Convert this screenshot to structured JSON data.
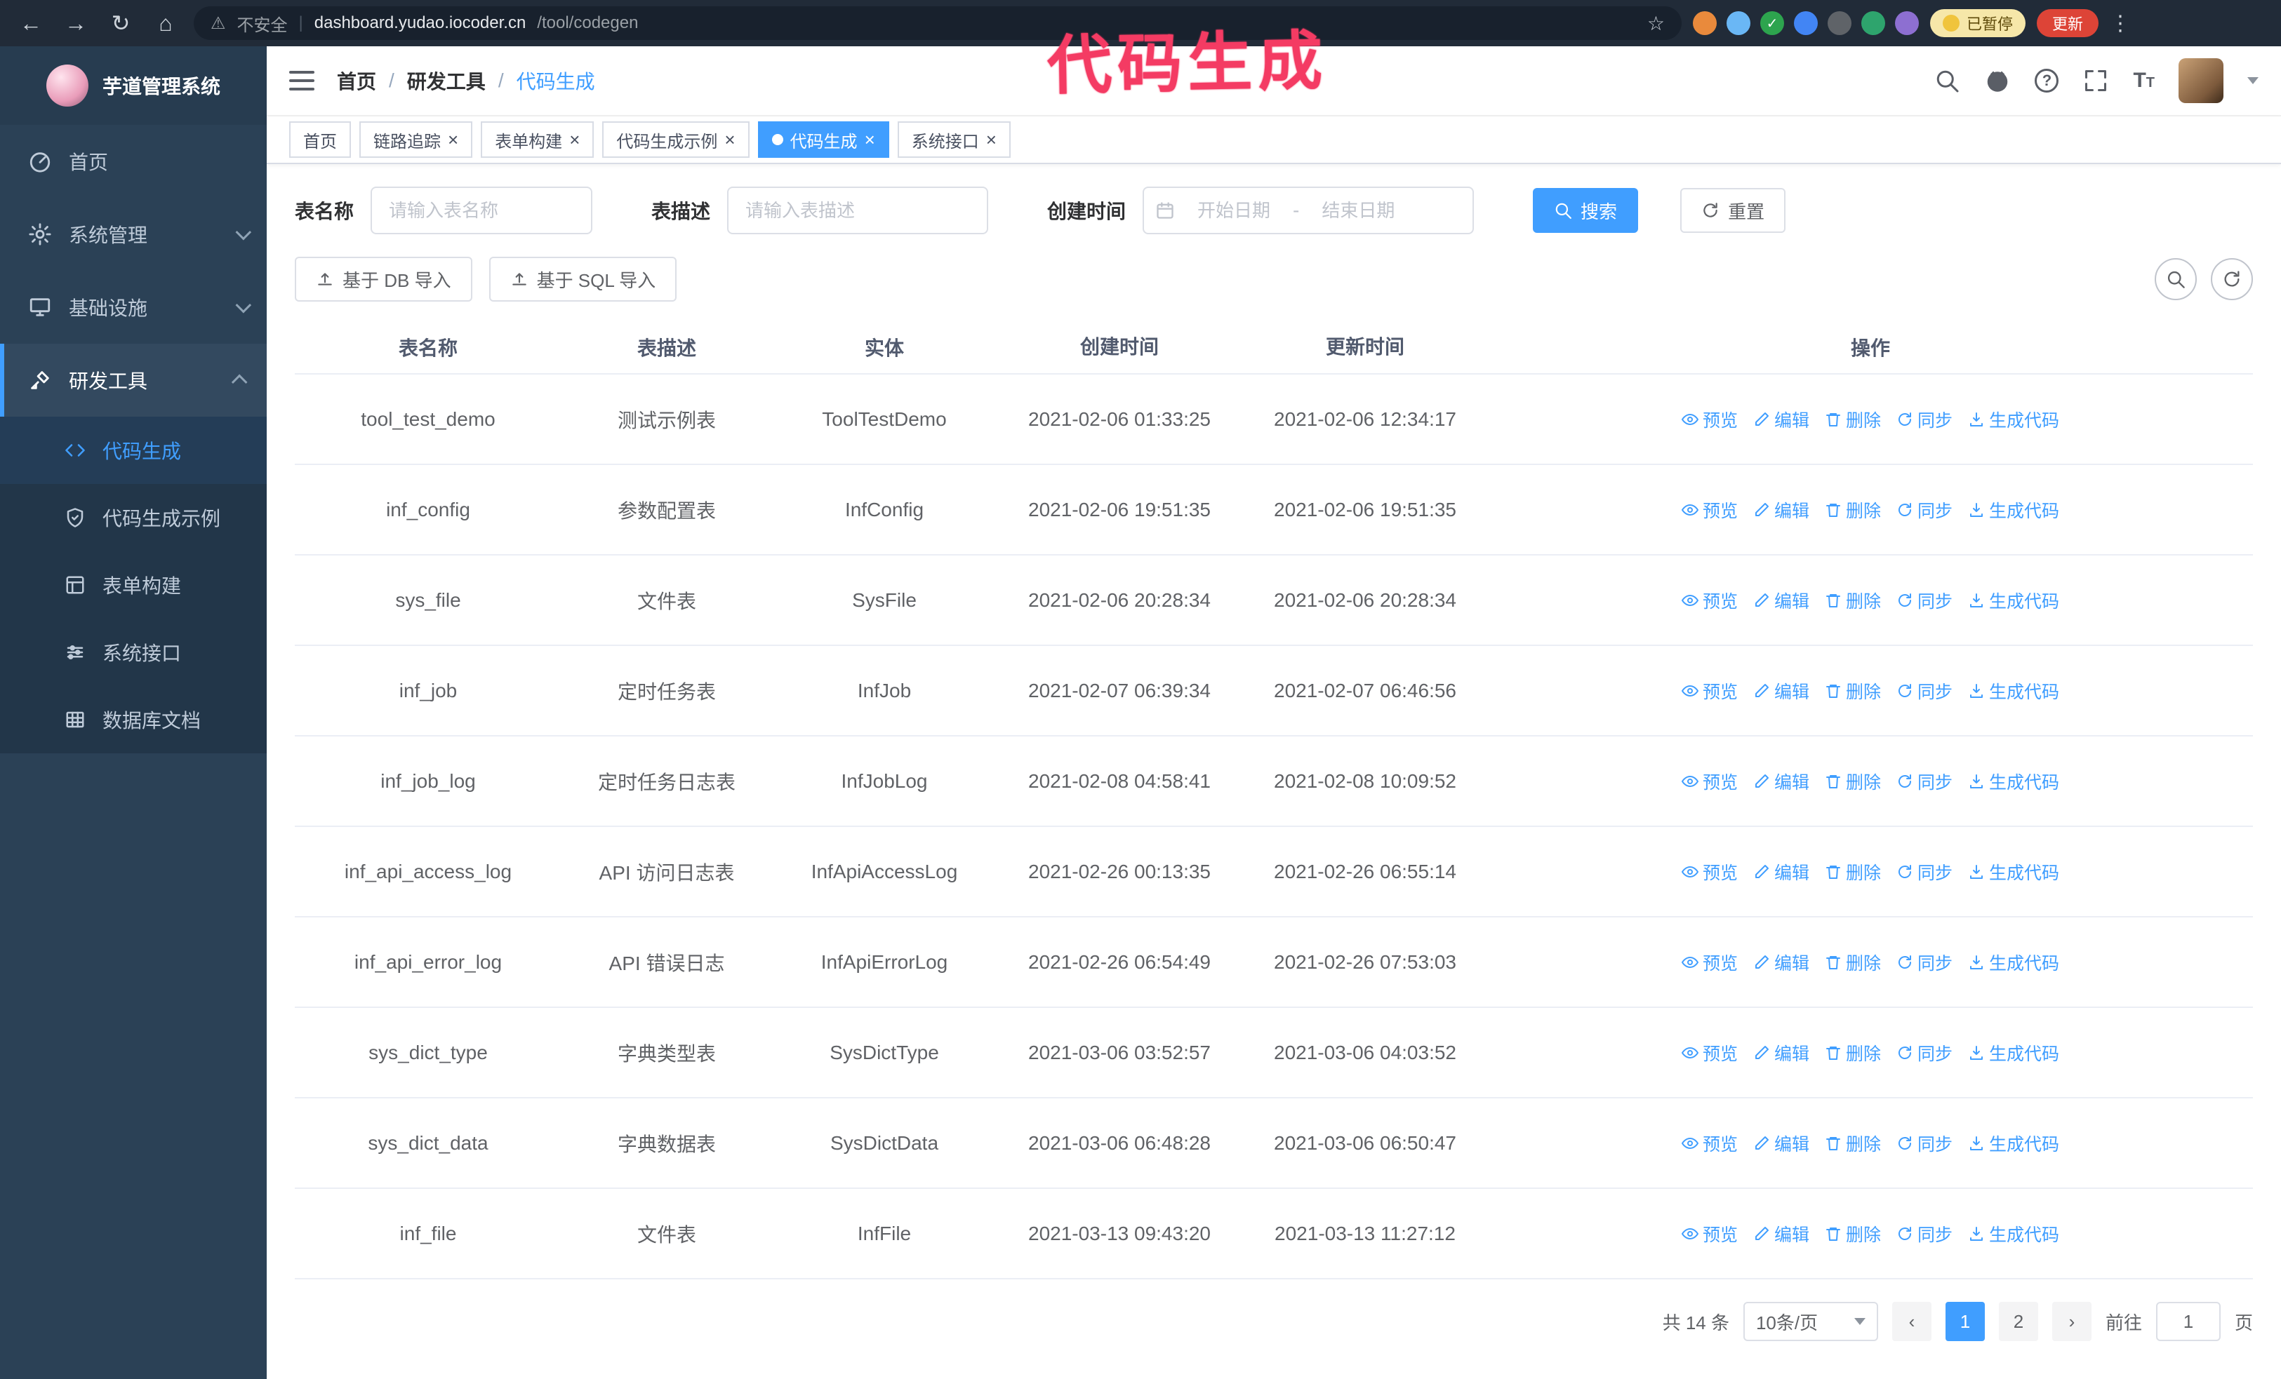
{
  "theme": {
    "primary": "#409eff",
    "annotation": "#f43b63",
    "sidebar_bg": "#2b4156",
    "chrome_bg": "#212b38",
    "update_red": "#dd4437",
    "paused_yellow": "#f6e7a9"
  },
  "icons": {
    "back": "←",
    "forward": "→",
    "reload": "↻",
    "home": "⌂",
    "warning": "⚠",
    "star": "☆",
    "kebab": "⋮",
    "close": "×",
    "check": "✓",
    "prev": "‹",
    "next": "›",
    "question": "?",
    "font_size": "T"
  },
  "annotation": {
    "text": "代码生成"
  },
  "browser": {
    "security_label": "不安全",
    "url_host": "dashboard.yudao.iocoder.cn",
    "url_path": "/tool/codegen",
    "url_divider": "|",
    "paused_badge": "已暂停",
    "update_button": "更新"
  },
  "sidebar": {
    "logo_title": "芋道管理系统",
    "items": [
      {
        "label": "首页"
      },
      {
        "label": "系统管理"
      },
      {
        "label": "基础设施"
      },
      {
        "label": "研发工具"
      }
    ],
    "subitems": [
      {
        "label": "代码生成",
        "active": true
      },
      {
        "label": "代码生成示例"
      },
      {
        "label": "表单构建"
      },
      {
        "label": "系统接口"
      },
      {
        "label": "数据库文档"
      }
    ]
  },
  "topbar": {
    "breadcrumb": [
      "首页",
      "研发工具",
      "代码生成"
    ],
    "separator": "/"
  },
  "tabs": [
    {
      "label": "首页",
      "closable": false,
      "active": false
    },
    {
      "label": "链路追踪",
      "closable": true,
      "active": false
    },
    {
      "label": "表单构建",
      "closable": true,
      "active": false
    },
    {
      "label": "代码生成示例",
      "closable": true,
      "active": false
    },
    {
      "label": "代码生成",
      "closable": true,
      "active": true
    },
    {
      "label": "系统接口",
      "closable": true,
      "active": false
    }
  ],
  "filters": {
    "name_label": "表名称",
    "name_placeholder": "请输入表名称",
    "desc_label": "表描述",
    "desc_placeholder": "请输入表描述",
    "time_label": "创建时间",
    "time_start_placeholder": "开始日期",
    "time_separator": "-",
    "time_end_placeholder": "结束日期",
    "search_button": "搜索",
    "reset_button": "重置"
  },
  "toolbar": {
    "import_db": "基于 DB 导入",
    "import_sql": "基于 SQL 导入"
  },
  "table": {
    "headers": [
      "表名称",
      "表描述",
      "实体",
      "创建时间",
      "更新时间",
      "操作"
    ],
    "actions": [
      "预览",
      "编辑",
      "删除",
      "同步",
      "生成代码"
    ],
    "rows": [
      {
        "name": "tool_test_demo",
        "desc": "测试示例表",
        "entity": "ToolTestDemo",
        "created": "2021-02-06 01:33:25",
        "updated": "2021-02-06 12:34:17"
      },
      {
        "name": "inf_config",
        "desc": "参数配置表",
        "entity": "InfConfig",
        "created": "2021-02-06 19:51:35",
        "updated": "2021-02-06 19:51:35"
      },
      {
        "name": "sys_file",
        "desc": "文件表",
        "entity": "SysFile",
        "created": "2021-02-06 20:28:34",
        "updated": "2021-02-06 20:28:34"
      },
      {
        "name": "inf_job",
        "desc": "定时任务表",
        "entity": "InfJob",
        "created": "2021-02-07 06:39:34",
        "updated": "2021-02-07 06:46:56"
      },
      {
        "name": "inf_job_log",
        "desc": "定时任务日志表",
        "entity": "InfJobLog",
        "created": "2021-02-08 04:58:41",
        "updated": "2021-02-08 10:09:52"
      },
      {
        "name": "inf_api_access_log",
        "desc": "API 访问日志表",
        "entity": "InfApiAccessLog",
        "created": "2021-02-26 00:13:35",
        "updated": "2021-02-26 06:55:14"
      },
      {
        "name": "inf_api_error_log",
        "desc": "API 错误日志",
        "entity": "InfApiErrorLog",
        "created": "2021-02-26 06:54:49",
        "updated": "2021-02-26 07:53:03"
      },
      {
        "name": "sys_dict_type",
        "desc": "字典类型表",
        "entity": "SysDictType",
        "created": "2021-03-06 03:52:57",
        "updated": "2021-03-06 04:03:52"
      },
      {
        "name": "sys_dict_data",
        "desc": "字典数据表",
        "entity": "SysDictData",
        "created": "2021-03-06 06:48:28",
        "updated": "2021-03-06 06:50:47"
      },
      {
        "name": "inf_file",
        "desc": "文件表",
        "entity": "InfFile",
        "created": "2021-03-13 09:43:20",
        "updated": "2021-03-13 11:27:12"
      }
    ]
  },
  "pagination": {
    "total": "共 14 条",
    "page_size": "10条/页",
    "pages": [
      "1",
      "2"
    ],
    "goto_prefix": "前往",
    "goto_value": "1",
    "goto_suffix": "页"
  }
}
